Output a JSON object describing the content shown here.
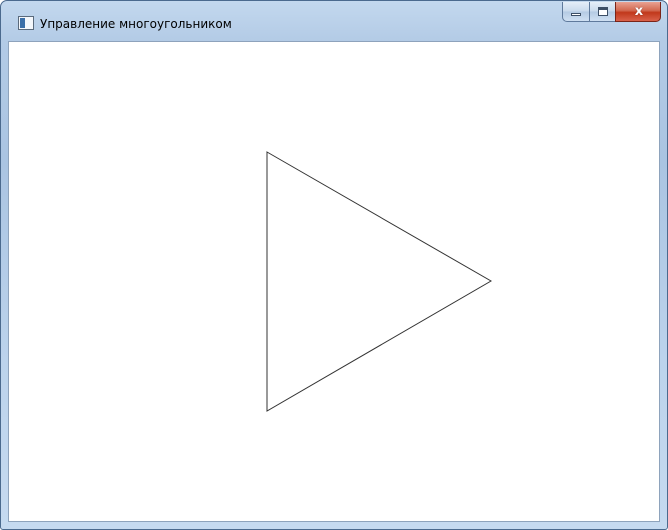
{
  "window": {
    "title": "Управление многоугольником",
    "icon": "app-window-icon",
    "controls": {
      "minimize_icon": "minimize-icon",
      "maximize_icon": "maximize-icon",
      "close_icon": "close-icon",
      "close_glyph": "x"
    }
  },
  "canvas": {
    "shape": "triangle",
    "stroke_color": "#333333",
    "fill_color": "#ffffff"
  }
}
